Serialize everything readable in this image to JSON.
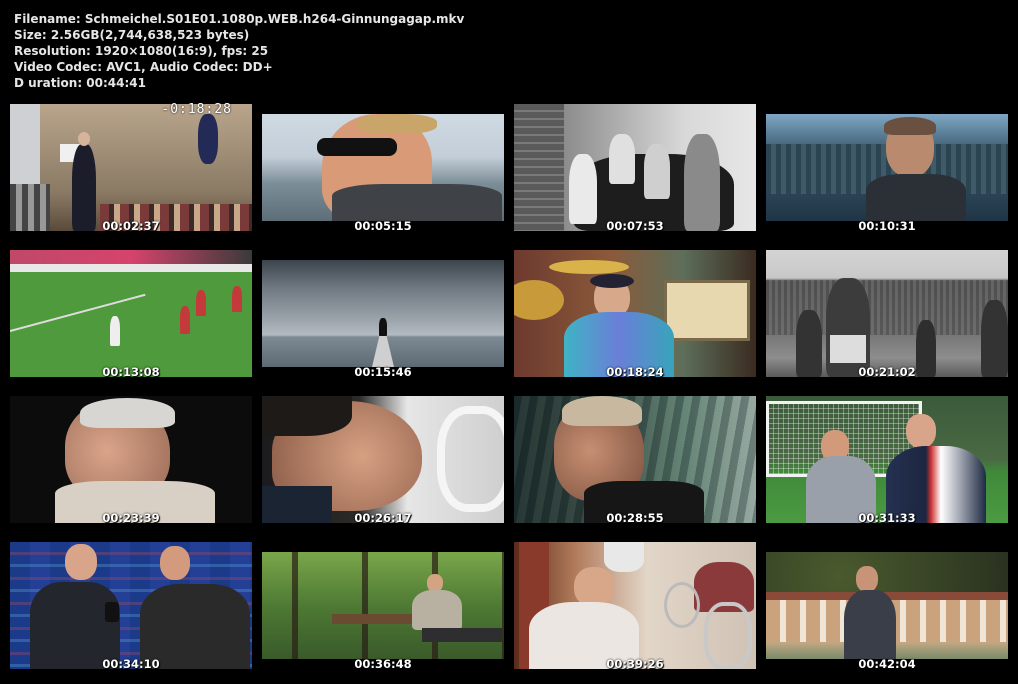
{
  "header": {
    "filename": "Filename: Schmeichel.S01E01.1080p.WEB.h264-Ginnungagap.mkv",
    "size": "Size: 2.56GB(2,744,638,523 bytes)",
    "resolution": "Resolution: 1920×1080(16:9), fps: 25",
    "codec": "Video Codec: AVC1, Audio Codec: DD+",
    "duration": "D uration: 00:44:41"
  },
  "thumbnails": [
    {
      "time": "00:02:37",
      "overlay": "-0:18:28"
    },
    {
      "time": "00:05:15"
    },
    {
      "time": "00:07:53"
    },
    {
      "time": "00:10:31"
    },
    {
      "time": "00:13:08"
    },
    {
      "time": "00:15:46"
    },
    {
      "time": "00:18:24"
    },
    {
      "time": "00:21:02"
    },
    {
      "time": "00:23:39"
    },
    {
      "time": "00:26:17"
    },
    {
      "time": "00:28:55"
    },
    {
      "time": "00:31:33"
    },
    {
      "time": "00:34:10"
    },
    {
      "time": "00:36:48"
    },
    {
      "time": "00:39:26"
    },
    {
      "time": "00:42:04"
    }
  ]
}
